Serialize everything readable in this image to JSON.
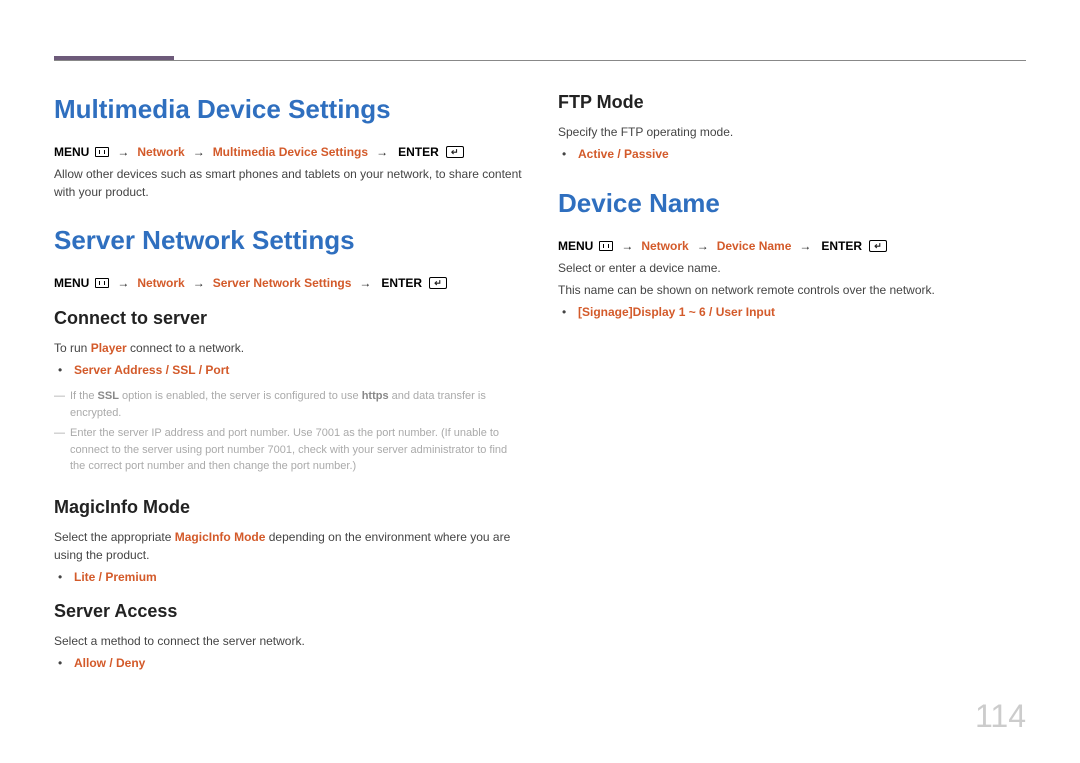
{
  "page_number": "114",
  "sec_multimedia": {
    "heading": "Multimedia Device Settings",
    "menupath_label": "MENU",
    "menupath_net": "Network",
    "menupath_item": "Multimedia Device Settings",
    "menupath_enter": "ENTER",
    "body": "Allow other devices such as smart phones and tablets on your network, to share content with your product."
  },
  "sec_server": {
    "heading": "Server Network Settings",
    "menupath_label": "MENU",
    "menupath_net": "Network",
    "menupath_item": "Server Network Settings",
    "menupath_enter": "ENTER",
    "sub_connect": {
      "heading": "Connect to server",
      "body_pre": "To run ",
      "body_player": "Player",
      "body_post": " connect to a network.",
      "option": "Server Address / SSL / Port",
      "note1_pre": "If the ",
      "note1_ssl": "SSL",
      "note1_mid": " option is enabled, the server is configured to use ",
      "note1_https": "https",
      "note1_post": " and data transfer is encrypted.",
      "note2": "Enter the server IP address and port number. Use 7001 as the port number. (If unable to connect to the server using port number 7001, check with your server administrator to find the correct port number and then change the port number.)"
    },
    "sub_magicinfo": {
      "heading": "MagicInfo Mode",
      "body_pre": "Select the appropriate ",
      "body_mode": "MagicInfo Mode",
      "body_post": " depending on the environment where you are using the product.",
      "option": "Lite / Premium"
    },
    "sub_access": {
      "heading": "Server Access",
      "body": "Select a method to connect the server network.",
      "option": "Allow / Deny"
    }
  },
  "sec_ftp": {
    "heading": "FTP Mode",
    "body": "Specify the FTP operating mode.",
    "option": "Active / Passive"
  },
  "sec_device": {
    "heading": "Device Name",
    "menupath_label": "MENU",
    "menupath_net": "Network",
    "menupath_item": "Device Name",
    "menupath_enter": "ENTER",
    "body1": "Select or enter a device name.",
    "body2": "This name can be shown on network remote controls over the network.",
    "option": "[Signage]Display 1 ~ 6 / User Input"
  }
}
